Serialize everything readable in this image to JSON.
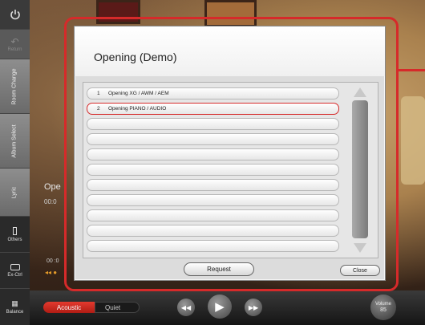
{
  "sidebar": {
    "power_icon": "power-icon",
    "return_label": "Return",
    "room_change_label": "Room Change",
    "album_select_label": "Album Select",
    "lyric_label": "Lyric",
    "others_label": "Others",
    "exctrl_label": "Ex-Ctrl",
    "balance_label": "Balance"
  },
  "background": {
    "track_title": "Ope",
    "track_time": "00:0",
    "time_small": "00 :0"
  },
  "dialog": {
    "title": "Opening (Demo)",
    "items": [
      {
        "num": "1",
        "label": "Opening XG / AWM / AEM",
        "selected": false
      },
      {
        "num": "2",
        "label": "Opening PIANO / AUDIO",
        "selected": true
      },
      {
        "num": "",
        "label": "",
        "selected": false
      },
      {
        "num": "",
        "label": "",
        "selected": false
      },
      {
        "num": "",
        "label": "",
        "selected": false
      },
      {
        "num": "",
        "label": "",
        "selected": false
      },
      {
        "num": "",
        "label": "",
        "selected": false
      },
      {
        "num": "",
        "label": "",
        "selected": false
      },
      {
        "num": "",
        "label": "",
        "selected": false
      },
      {
        "num": "",
        "label": "",
        "selected": false
      },
      {
        "num": "",
        "label": "",
        "selected": false
      }
    ],
    "request_label": "Request",
    "close_label": "Close",
    "highlight_color": "#d62a2a"
  },
  "bottom": {
    "acoustic_label": "Acoustic",
    "quiet_label": "Quiet",
    "volume_label": "Volume",
    "volume_value": "85"
  }
}
